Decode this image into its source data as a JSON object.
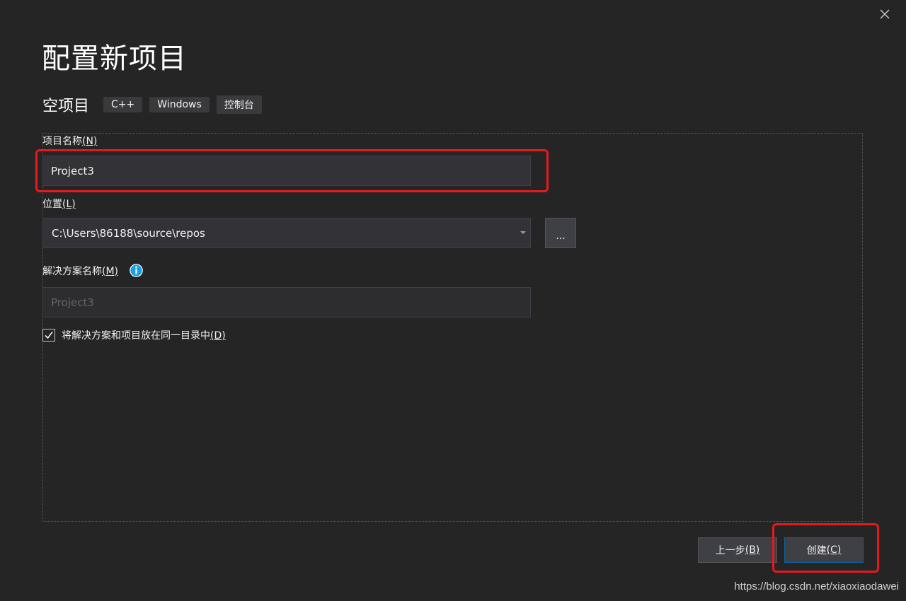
{
  "dialog": {
    "title": "配置新项目",
    "close_icon": "close-icon"
  },
  "template": {
    "name": "空项目",
    "tags": [
      "C++",
      "Windows",
      "控制台"
    ]
  },
  "form": {
    "project_name": {
      "label": "项目名称",
      "mnemonic": "(N)",
      "value": "Project3"
    },
    "location": {
      "label": "位置",
      "mnemonic": "(L)",
      "value": "C:\\Users\\86188\\source\\repos",
      "browse_label": "..."
    },
    "solution_name": {
      "label": "解决方案名称",
      "mnemonic": "(M)",
      "placeholder": "Project3",
      "info_icon": "info-icon"
    },
    "same_directory": {
      "label": "将解决方案和项目放在同一目录中",
      "mnemonic": "(D)",
      "checked": true
    }
  },
  "buttons": {
    "back": {
      "label": "上一步",
      "mnemonic": "(B)"
    },
    "create": {
      "label": "创建",
      "mnemonic": "(C)"
    }
  },
  "annotations": {
    "highlight_color": "#e8191c"
  },
  "watermark": "https://blog.csdn.net/xiaoxiaodawei",
  "colors": {
    "background": "#252526",
    "input_bg": "#333337",
    "accent": "#0e639c",
    "info_blue": "#1ba1e2"
  }
}
